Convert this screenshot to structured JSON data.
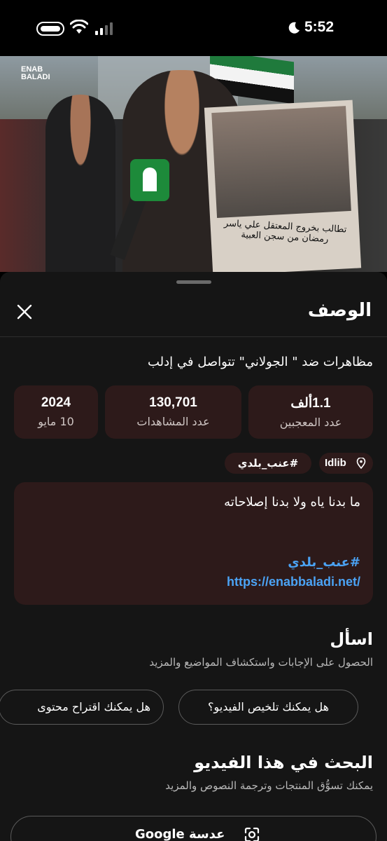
{
  "status_bar": {
    "time": "5:52"
  },
  "video": {
    "watermark": "ENAB BALADI",
    "sign_caption": "تطالب بخروج المعتقل علي ياسر رمضان من سجن العبية"
  },
  "sheet": {
    "title": "الوصف",
    "video_title": "مظاهرات ضد \" الجولاني\" تتواصل في إدلب",
    "stats": [
      {
        "value": "1.1ألف",
        "label": "عدد المعجبين"
      },
      {
        "value": "130,701",
        "label": "عدد المشاهدات"
      },
      {
        "value": "2024",
        "label": "10 مايو"
      }
    ],
    "chips": {
      "location": "Idlib",
      "hashtag": "#عنب_بلدي"
    },
    "description": {
      "line1": "ما بدنا ياه ولا بدنا إصلاحاته",
      "hashtag": "#عنب_بلدي",
      "link": "https://enabbaladi.net/"
    },
    "ask": {
      "title": "اسأل",
      "subtitle": "الحصول على الإجابات واستكشاف المواضيع والمزيد",
      "suggestions": [
        "هل يمكنك تلخيص الفيديو؟",
        "هل يمكنك اقتراح محتوى"
      ]
    },
    "search": {
      "title": "البحث في هذا الفيديو",
      "subtitle": "يمكنك تسوُّق المنتجات وترجمة النصوص والمزيد",
      "lens_label": "عدسة Google"
    }
  },
  "colors": {
    "sheet_bg": "#151515",
    "card_bg": "#2d1a1a",
    "link": "#4ba3f5"
  },
  "icons": [
    "battery-icon",
    "wifi-icon",
    "cellular-icon",
    "moon-icon",
    "close-icon",
    "location-pin-icon",
    "camera-lens-icon"
  ]
}
